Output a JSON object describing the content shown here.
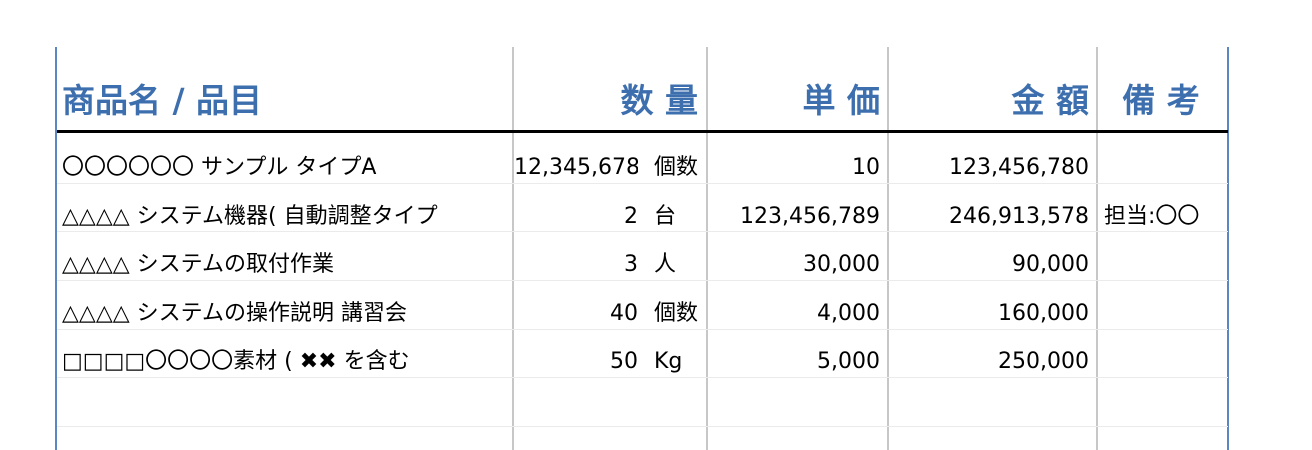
{
  "header": {
    "product": "商品名 / 品目",
    "quantity": "数 量",
    "unit_price": "単 価",
    "amount": "金 額",
    "remarks": "備 考"
  },
  "rows": [
    {
      "product": "〇〇〇〇〇〇 サンプル タイプA",
      "qty": "12,345,678",
      "unit": "個数",
      "price": "10",
      "amount": "123,456,780",
      "remarks": ""
    },
    {
      "product": "△△△△ システム機器( 自動調整タイプ",
      "qty": "2",
      "unit": "台",
      "price": "123,456,789",
      "amount": "246,913,578",
      "remarks": "担当:〇〇"
    },
    {
      "product": "△△△△ システムの取付作業",
      "qty": "3",
      "unit": "人",
      "price": "30,000",
      "amount": "90,000",
      "remarks": ""
    },
    {
      "product": "△△△△ システムの操作説明 講習会",
      "qty": "40",
      "unit": "個数",
      "price": "4,000",
      "amount": "160,000",
      "remarks": ""
    },
    {
      "product": "□□□□〇〇〇〇素材 ( ✖✖ を含む",
      "qty": "50",
      "unit": "Kg",
      "price": "5,000",
      "amount": "250,000",
      "remarks": ""
    }
  ],
  "colors": {
    "header_text": "#3d6fae",
    "outer_border": "#5b86bf",
    "inner_grid": "#c7c7c7"
  }
}
